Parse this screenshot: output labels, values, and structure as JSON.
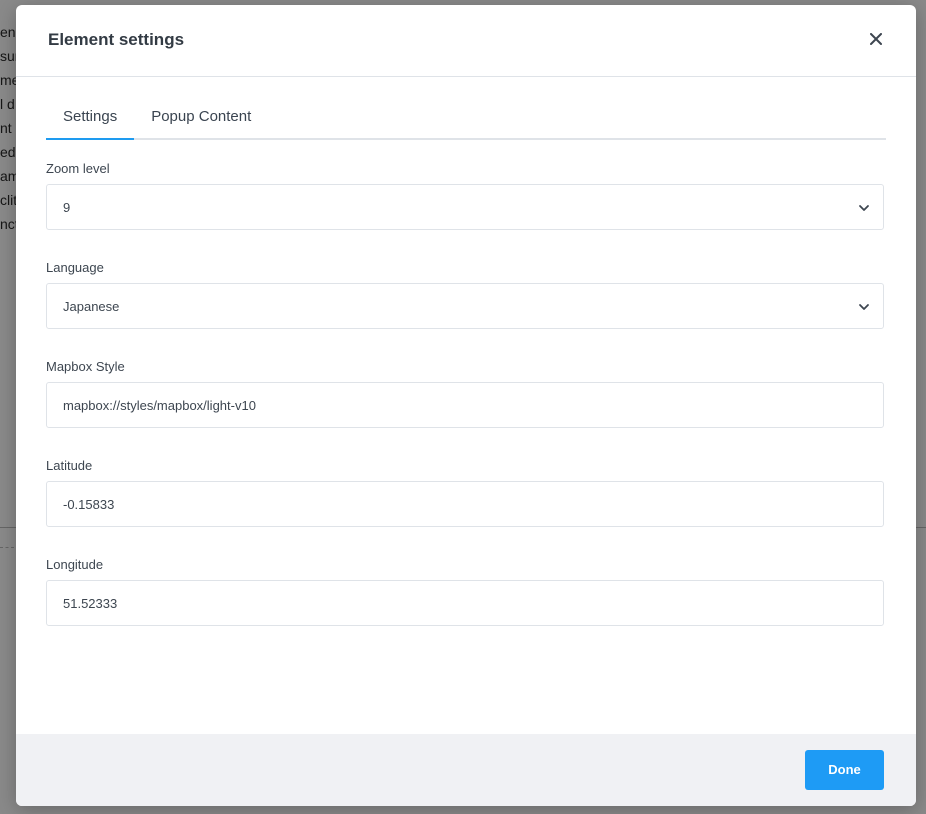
{
  "background": {
    "text_fragments": [
      "en,",
      "sum",
      "me",
      "l d",
      "nt",
      "ed",
      "am",
      "clit",
      "nct"
    ]
  },
  "modal": {
    "title": "Element settings",
    "close_icon": "close-icon",
    "tabs": [
      {
        "label": "Settings",
        "active": true
      },
      {
        "label": "Popup Content",
        "active": false
      }
    ],
    "fields": {
      "zoom": {
        "label": "Zoom level",
        "value": "9",
        "type": "select"
      },
      "language": {
        "label": "Language",
        "value": "Japanese",
        "type": "select"
      },
      "mapbox_style": {
        "label": "Mapbox Style",
        "value": "mapbox://styles/mapbox/light-v10",
        "type": "text"
      },
      "latitude": {
        "label": "Latitude",
        "value": "-0.15833",
        "type": "text"
      },
      "longitude": {
        "label": "Longitude",
        "value": "51.52333",
        "type": "text"
      }
    },
    "footer": {
      "done_label": "Done"
    },
    "colors": {
      "accent": "#1e9bf5",
      "footer_bg": "#f0f1f4"
    }
  }
}
